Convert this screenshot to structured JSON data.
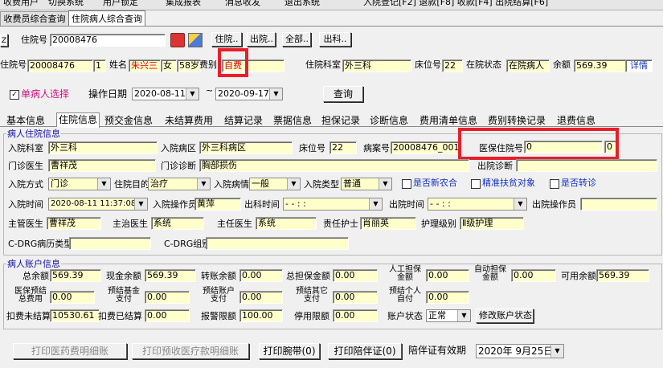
{
  "window_tabs": [
    "收费员综合查询",
    "住院病人综合查询"
  ],
  "toolbar_top": [
    "收费用户",
    "切换系统",
    "用户锁定",
    "集成报表",
    "消息收发",
    "退出系统",
    "入院登记[F2]  退款[F8]  收款[F4]  出院结算[F6]"
  ],
  "search": {
    "label": "住院号",
    "value": "20008476",
    "buttons": [
      "住院..",
      "出院..",
      "全部..",
      "出科.."
    ]
  },
  "patient": {
    "inpatient_no_label": "住院号",
    "inpatient_no": "20008476",
    "count": "1",
    "name_label": "姓名",
    "name": "朱兴三",
    "gender": "女",
    "age": "58岁",
    "fee_type_label": "费别",
    "fee_type": "自费",
    "dept_label": "住院科室",
    "dept": "外三科",
    "bed_label": "床位号",
    "bed": "22",
    "status_label": "在院状态",
    "status": "在院病人",
    "balance_label": "余额",
    "balance": "569.39",
    "detail": "详情"
  },
  "filter": {
    "single_patient": "单病人选择",
    "date_label": "操作日期",
    "date_from": "2020-08-11",
    "tilde": "~",
    "date_to": "2020-09-17",
    "query_button": "查询"
  },
  "tabs": [
    "基本信息",
    "住院信息",
    "预交金信息",
    "未结算费用",
    "结算记录",
    "票据信息",
    "担保记录",
    "诊断信息",
    "费用清单信息",
    "费别转换记录",
    "退费信息"
  ],
  "inpatient_info": {
    "section_title": "病人住院信息",
    "admit_dept_label": "入院科室",
    "admit_dept": "外三科",
    "admit_ward_label": "入院病区",
    "admit_ward": "外三科病区",
    "bed_label": "床位号",
    "bed": "22",
    "case_no_label": "病案号",
    "case_no": "20008476_001",
    "insurance_no_label": "医保住院号",
    "insurance_no": "0",
    "insurance_extra": "0",
    "clinic_doctor_label": "门诊医生",
    "clinic_doctor": "曹祥茂",
    "clinic_diag_label": "门诊诊断",
    "clinic_diag": "胸部损伤",
    "discharge_diag_label": "出院诊断",
    "admit_mode_label": "入院方式",
    "admit_mode": "门诊",
    "admit_purpose_label": "住院目的",
    "admit_purpose": "治疗",
    "admit_condition_label": "入院病情",
    "admit_condition": "一般",
    "admit_type_label": "入院类型",
    "admit_type": "普通",
    "new_rural_label": "是否新农合",
    "poverty_label": "精准扶贫对象",
    "transfer_label": "是否转诊",
    "admit_time_label": "入院时间",
    "admit_time": "2020-08-11 11:37:08",
    "admit_operator_label": "入院操作员",
    "admit_operator": "黄萍",
    "out_dept_time_label": "出科时间",
    "out_dept_time": "-   -     :  :",
    "discharge_time_label": "出院时间",
    "discharge_time": "-   -     :  :",
    "discharge_operator_label": "出院操作员",
    "chief_doctor_label": "主管医生",
    "chief_doctor": "曹祥茂",
    "attending_label": "主治医生",
    "attending": "系统",
    "director_label": "主任医生",
    "director": "系统",
    "nurse_label": "责任护士",
    "nurse": "肖丽英",
    "nursing_level_label": "护理级别",
    "nursing_level": "Ⅱ级护理",
    "cdrg_type_label": "C-DRG病历类型",
    "cdrg_group_label": "C-DRG组别"
  },
  "account": {
    "section_title": "病人账户信息",
    "total_balance_label": "总余额",
    "total_balance": "569.39",
    "cash_balance_label": "现金余额",
    "cash_balance": "569.39",
    "transfer_balance_label": "转账余额",
    "transfer_balance": "0.00",
    "guarantee_total_label": "总担保金额",
    "guarantee_total": "0.00",
    "manual_guarantee_label": "人工担保金额",
    "manual_guarantee": "0.00",
    "auto_guarantee_label": "自动担保金额",
    "auto_guarantee": "0.00",
    "available_label": "可用余额",
    "available": "569.39",
    "insurance_total_label": "医保预结总费用",
    "insurance_total": "0.00",
    "fund_pay_label": "预结基金支付",
    "fund_pay": "0.00",
    "account_pay_label": "预结账户支付",
    "account_pay": "0.00",
    "other_pay_label": "预结其它支付",
    "other_pay": "0.00",
    "self_pay_label": "预结个人自付",
    "self_pay": "0.00",
    "deduct_unsettled_label": "扣费未结算",
    "deduct_unsettled": "10530.61",
    "deduct_settled_label": "扣费已结算",
    "deduct_settled": "0.00",
    "alarm_limit_label": "报警限额",
    "alarm_limit": "100.00",
    "stop_limit_label": "停用限额",
    "stop_limit": "0.00",
    "status_label": "账户状态",
    "status": "正常",
    "modify_button": "修改账户状态"
  },
  "bottom": {
    "print_drug": "打印医药费明细账",
    "print_prepaid": "打印预收医疗款明细账",
    "print_band": "打印腕带(0)",
    "print_escort": "打印陪伴证(0)",
    "escort_valid_label": "陪伴证有效期",
    "escort_valid": "2020年 9月25日"
  },
  "colors": {
    "highlight_red": "#e81f2a",
    "field_bg": "#ffffcc",
    "tab_active": "#ffffff"
  }
}
